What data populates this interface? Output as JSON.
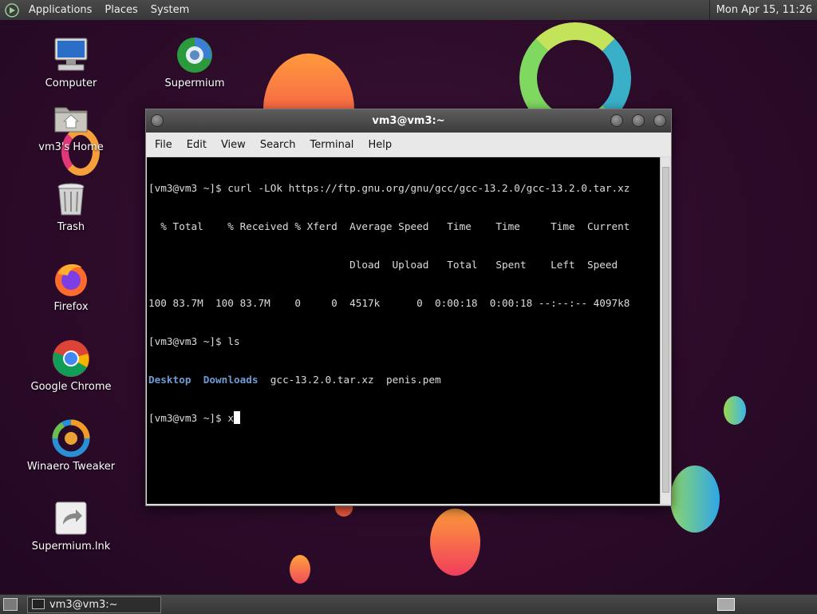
{
  "top_panel": {
    "menus": [
      "Applications",
      "Places",
      "System"
    ],
    "clock": "Mon Apr 15, 11:26"
  },
  "desktop_icons": [
    {
      "label": "Computer",
      "icon": "computer-icon"
    },
    {
      "label": "Supermium",
      "icon": "supermium-icon"
    },
    {
      "label": "vm3's Home",
      "icon": "home-folder-icon"
    },
    {
      "label": "Trash",
      "icon": "trash-icon"
    },
    {
      "label": "Firefox",
      "icon": "firefox-icon"
    },
    {
      "label": "Google Chrome",
      "icon": "chrome-icon"
    },
    {
      "label": "Winaero Tweaker",
      "icon": "winaero-tweaker-icon"
    },
    {
      "label": "Supermium.lnk",
      "icon": "shortcut-icon"
    }
  ],
  "terminal": {
    "title": "vm3@vm3:~",
    "menus": [
      "File",
      "Edit",
      "View",
      "Search",
      "Terminal",
      "Help"
    ],
    "lines": [
      "[vm3@vm3 ~]$ curl -LOk https://ftp.gnu.org/gnu/gcc/gcc-13.2.0/gcc-13.2.0.tar.xz",
      "  % Total    % Received % Xferd  Average Speed   Time    Time     Time  Current",
      "                                 Dload  Upload   Total   Spent    Left  Speed",
      "100 83.7M  100 83.7M    0     0  4517k      0  0:00:18  0:00:18 --:--:-- 4097k8",
      "[vm3@vm3 ~]$ ls"
    ],
    "ls_output": {
      "dirs": [
        "Desktop",
        "Downloads"
      ],
      "files": [
        "gcc-13.2.0.tar.xz",
        "penis.pem"
      ]
    },
    "prompt": "[vm3@vm3 ~]$ ",
    "current_input": "x"
  },
  "taskbar": {
    "window_button": "vm3@vm3:~"
  },
  "colors": {
    "directory_blue": "#6f9bd3",
    "terminal_bg": "#000000",
    "desktop_bg": "#2c0b29"
  }
}
